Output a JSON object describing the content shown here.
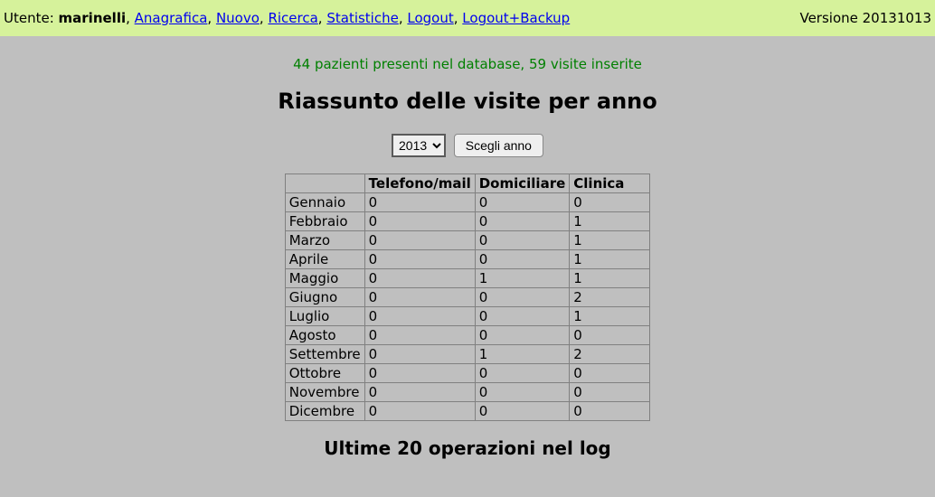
{
  "topbar": {
    "user_label": "Utente: ",
    "user_name": "marinelli",
    "links": [
      "Anagrafica",
      "Nuovo",
      "Ricerca",
      "Statistiche",
      "Logout",
      "Logout+Backup"
    ],
    "version_label": "Versione 20131013"
  },
  "status_line": "44 pazienti presenti nel database, 59 visite inserite",
  "page_title": "Riassunto delle visite per anno",
  "year_form": {
    "selected_year": "2013",
    "button_label": "Scegli anno"
  },
  "table": {
    "headers": [
      "",
      "Telefono/mail",
      "Domiciliare",
      "Clinica"
    ],
    "rows": [
      {
        "month": "Gennaio",
        "telefono": 0,
        "domiciliare": 0,
        "clinica": 0
      },
      {
        "month": "Febbraio",
        "telefono": 0,
        "domiciliare": 0,
        "clinica": 1
      },
      {
        "month": "Marzo",
        "telefono": 0,
        "domiciliare": 0,
        "clinica": 1
      },
      {
        "month": "Aprile",
        "telefono": 0,
        "domiciliare": 0,
        "clinica": 1
      },
      {
        "month": "Maggio",
        "telefono": 0,
        "domiciliare": 1,
        "clinica": 1
      },
      {
        "month": "Giugno",
        "telefono": 0,
        "domiciliare": 0,
        "clinica": 2
      },
      {
        "month": "Luglio",
        "telefono": 0,
        "domiciliare": 0,
        "clinica": 1
      },
      {
        "month": "Agosto",
        "telefono": 0,
        "domiciliare": 0,
        "clinica": 0
      },
      {
        "month": "Settembre",
        "telefono": 0,
        "domiciliare": 1,
        "clinica": 2
      },
      {
        "month": "Ottobre",
        "telefono": 0,
        "domiciliare": 0,
        "clinica": 0
      },
      {
        "month": "Novembre",
        "telefono": 0,
        "domiciliare": 0,
        "clinica": 0
      },
      {
        "month": "Dicembre",
        "telefono": 0,
        "domiciliare": 0,
        "clinica": 0
      }
    ]
  },
  "log_title": "Ultime 20 operazioni nel log"
}
